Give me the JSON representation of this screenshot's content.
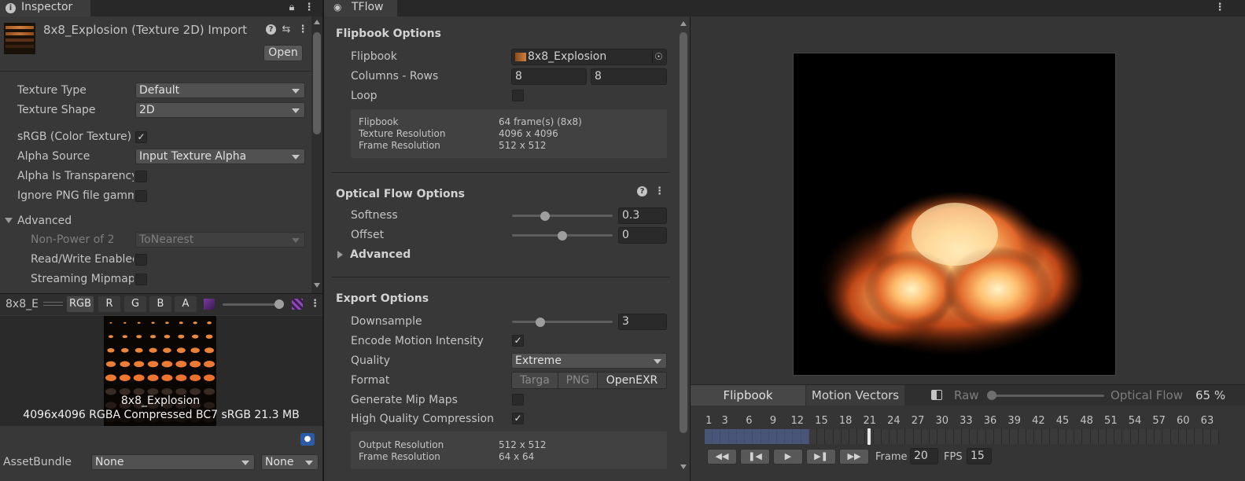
{
  "inspector": {
    "tab_label": "Inspector",
    "asset_title": "8x8_Explosion (Texture 2D) Import",
    "open_label": "Open",
    "rows": [
      {
        "label": "Texture Type",
        "value": "Default"
      },
      {
        "label": "Texture Shape",
        "value": "2D"
      },
      {
        "label": "sRGB (Color Texture)",
        "checked": true
      },
      {
        "label": "Alpha Source",
        "value": "Input Texture Alpha"
      },
      {
        "label": "Alpha Is Transparency",
        "checked": false
      },
      {
        "label": "Ignore PNG file gamma",
        "checked": false
      }
    ],
    "advanced_label": "Advanced",
    "advanced_rows": [
      {
        "label": "Non-Power of 2",
        "value": "ToNearest"
      },
      {
        "label": "Read/Write Enabled",
        "checked": false
      },
      {
        "label": "Streaming Mipmaps",
        "checked": false
      }
    ],
    "preview_bar": {
      "name": "8x8_E",
      "channels": [
        "RGB",
        "R",
        "G",
        "B",
        "A"
      ]
    },
    "preview_title": "8x8_Explosion",
    "preview_info": "4096x4096  RGBA Compressed BC7 sRGB   21.3 MB",
    "assetbundle": {
      "label": "AssetBundle",
      "name": "None",
      "variant": "None"
    }
  },
  "tflow": {
    "tab_label": "TFlow",
    "flipbook_options": {
      "header": "Flipbook Options",
      "flipbook_label": "Flipbook",
      "flipbook_value": "8x8_Explosion",
      "columns_rows_label": "Columns - Rows",
      "columns": "8",
      "rows": "8",
      "loop_label": "Loop",
      "info": [
        {
          "k": "Flipbook",
          "v": "64 frame(s) (8x8)"
        },
        {
          "k": "Texture Resolution",
          "v": "4096 x 4096"
        },
        {
          "k": "Frame Resolution",
          "v": "512 x 512"
        }
      ]
    },
    "optical_flow_options": {
      "header": "Optical Flow Options",
      "softness_label": "Softness",
      "softness_value": "0.3",
      "softness_level": 0.33,
      "offset_label": "Offset",
      "offset_value": "0",
      "offset_level": 0.5,
      "advanced_label": "Advanced"
    },
    "export_options": {
      "header": "Export Options",
      "downsample_label": "Downsample",
      "downsample_value": "3",
      "downsample_level": 0.28,
      "encode_label": "Encode Motion Intensity",
      "quality_label": "Quality",
      "quality_value": "Extreme",
      "format_label": "Format",
      "formats": [
        "Targa",
        "PNG",
        "OpenEXR"
      ],
      "selected_format": "OpenEXR",
      "mip_label": "Generate Mip Maps",
      "hq_label": "High Quality Compression",
      "info": [
        {
          "k": "Output Resolution",
          "v": "512 x 512"
        },
        {
          "k": "Frame Resolution",
          "v": "64 x 64"
        }
      ]
    },
    "viewer": {
      "tabs": [
        "Flipbook",
        "Motion Vectors"
      ],
      "raw_label": "Raw",
      "optical_flow_label": "Optical Flow",
      "zoom": "65 %",
      "ticks": [
        "1",
        "3",
        "6",
        "9",
        "12",
        "15",
        "18",
        "21",
        "24",
        "27",
        "30",
        "33",
        "36",
        "39",
        "42",
        "45",
        "48",
        "51",
        "54",
        "57",
        "60",
        "63"
      ],
      "frame_label": "Frame",
      "frame_value": "20",
      "fps_label": "FPS",
      "fps_value": "15",
      "playhead_frame": 20,
      "total_frames": 64
    }
  }
}
